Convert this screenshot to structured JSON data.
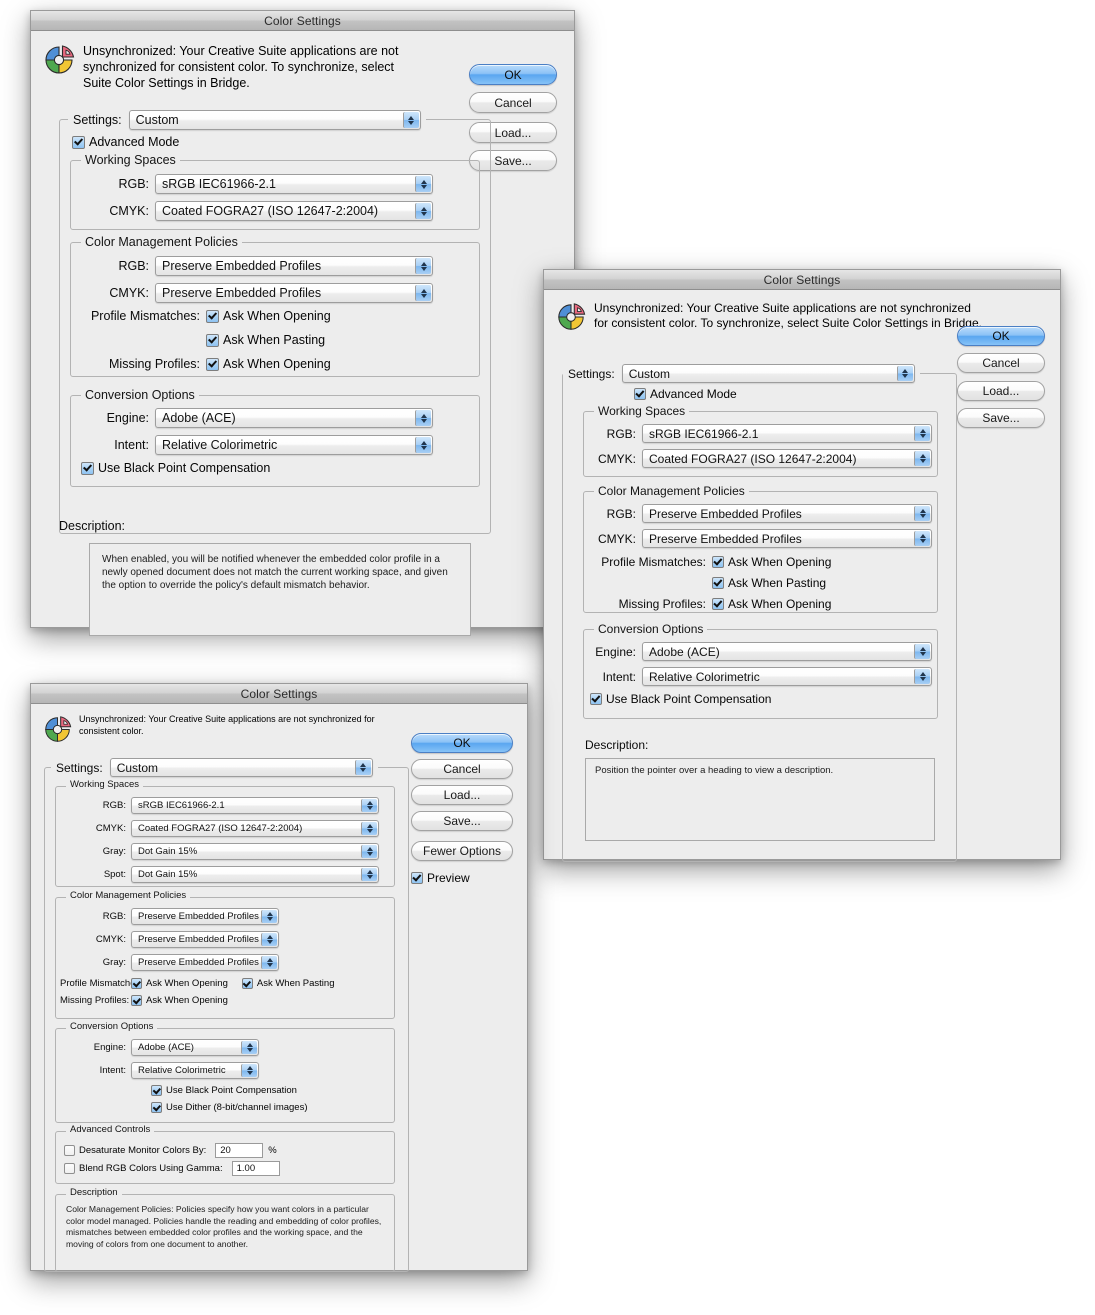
{
  "common": {
    "window_title": "Color Settings",
    "app_icon": "color-wheel-icon",
    "labels": {
      "settings": "Settings:",
      "rgb": "RGB:",
      "cmyk": "CMYK:",
      "gray": "Gray:",
      "spot": "Spot:",
      "engine": "Engine:",
      "intent": "Intent:",
      "profile_mismatches": "Profile Mismatches:",
      "missing_profiles": "Missing Profiles:",
      "description": "Description:"
    },
    "groups": {
      "working_spaces": "Working Spaces",
      "color_management_policies": "Color Management Policies",
      "conversion_options": "Conversion Options",
      "advanced_controls": "Advanced Controls",
      "description": "Description"
    },
    "values": {
      "settings_custom": "Custom",
      "rgb_space": "sRGB IEC61966-2.1",
      "cmyk_space": "Coated FOGRA27 (ISO 12647-2:2004)",
      "gray_space": "Dot Gain 15%",
      "spot_space": "Dot Gain 15%",
      "policy_preserve": "Preserve Embedded Profiles",
      "engine_value": "Adobe (ACE)",
      "intent_value": "Relative Colorimetric"
    },
    "checks": {
      "advanced_mode": "Advanced Mode",
      "ask_when_opening": "Ask When Opening",
      "ask_when_pasting": "Ask When Pasting",
      "black_point": "Use Black Point Compensation",
      "use_dither": "Use Dither (8-bit/channel images)",
      "desaturate": "Desaturate Monitor Colors By:",
      "blend_gamma": "Blend RGB Colors Using Gamma:",
      "preview": "Preview"
    },
    "buttons": {
      "ok": "OK",
      "cancel": "Cancel",
      "load": "Load...",
      "save": "Save...",
      "fewer_options": "Fewer Options"
    },
    "accent_blue": "#5aa6f0",
    "window_bg": "#ededed"
  },
  "dialog1": {
    "warning": "Unsynchronized: Your Creative Suite applications are not synchronized for consistent color. To synchronize, select Suite Color Settings in Bridge.",
    "description_text": "When enabled, you will be notified whenever the embedded color profile in a newly opened document does not match the current working space, and given the option to override the policy's default mismatch behavior."
  },
  "dialog2": {
    "warning": "Unsynchronized: Your Creative Suite applications are not synchronized for consistent color. To synchronize, select Suite Color Settings in Bridge.",
    "description_text": "Position the pointer over a heading to view a description."
  },
  "dialog3": {
    "warning": "Unsynchronized: Your Creative Suite applications are not synchronized for consistent color.",
    "desaturate_value": "20",
    "desaturate_unit": "%",
    "blend_gamma_value": "1.00",
    "description_text": "Color Management Policies:  Policies specify how you want colors in a particular color model managed.  Policies handle the reading and embedding of color profiles, mismatches between embedded color profiles and the working space, and the moving of colors from one document to another."
  }
}
